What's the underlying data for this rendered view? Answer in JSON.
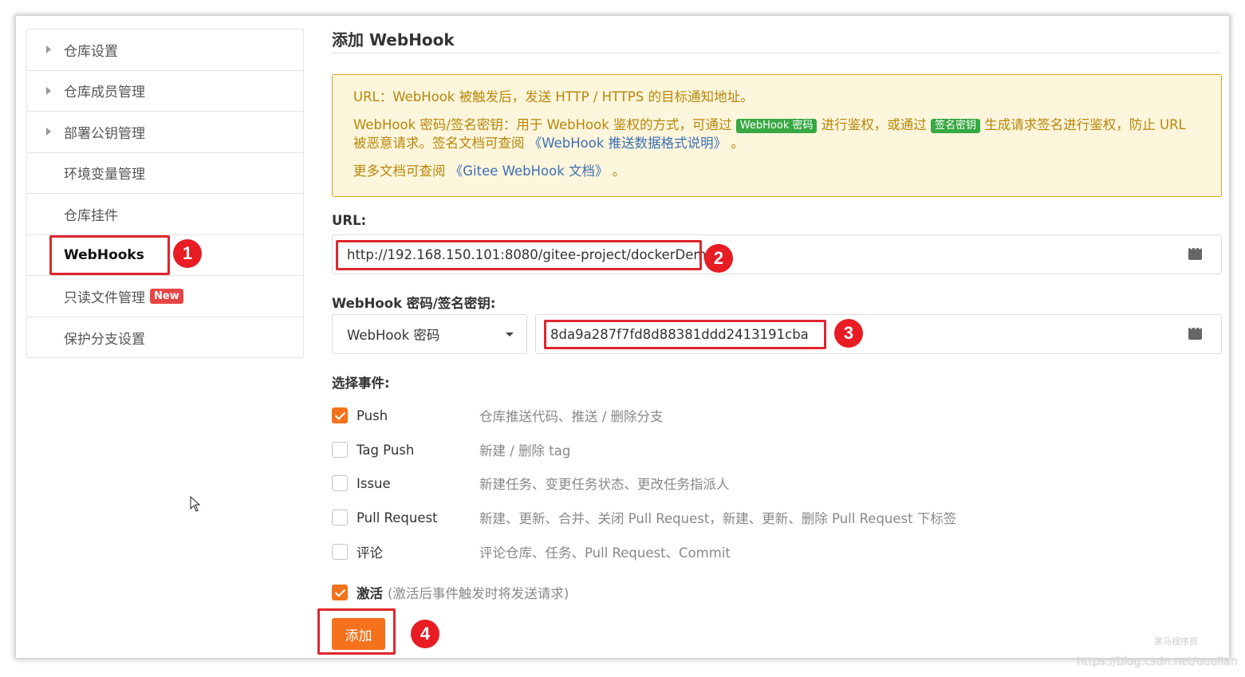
{
  "sidebar": {
    "items": [
      {
        "label": "仓库设置",
        "has_arrow": true
      },
      {
        "label": "仓库成员管理",
        "has_arrow": true
      },
      {
        "label": "部署公钥管理",
        "has_arrow": true
      },
      {
        "label": "环境变量管理",
        "has_arrow": false
      },
      {
        "label": "仓库挂件",
        "has_arrow": false
      },
      {
        "label": "WebHooks",
        "has_arrow": false,
        "active": true
      },
      {
        "label": "只读文件管理",
        "has_arrow": false,
        "badge": "New"
      },
      {
        "label": "保护分支设置",
        "has_arrow": false
      }
    ]
  },
  "main": {
    "title": "添加 WebHook",
    "notice": {
      "line1": "URL：WebHook 被触发后，发送 HTTP / HTTPS 的目标通知地址。",
      "line2_a": "WebHook 密码/签名密钥：用于 WebHook 鉴权的方式，可通过",
      "line2_tag1": "WebHook 密码",
      "line2_b": "进行鉴权，或通过",
      "line2_tag2": "签名密钥",
      "line2_c": "生成请求签名进行鉴权，防止 URL 被恶意请求。签名文档可查阅",
      "line2_link": "《WebHook 推送数据格式说明》",
      "line2_end": "。",
      "line3_a": "更多文档可查阅",
      "line3_link": "《Gitee WebHook 文档》",
      "line3_end": "。"
    },
    "url_label": "URL:",
    "url_value": "http://192.168.150.101:8080/gitee-project/dockerDemo",
    "secret_label": "WebHook 密码/签名密钥:",
    "secret_type": "WebHook 密码",
    "secret_value": "8da9a287f7fd8d88381ddd2413191cba",
    "events_label": "选择事件:",
    "events": [
      {
        "name": "Push",
        "desc": "仓库推送代码、推送 / 删除分支",
        "checked": true
      },
      {
        "name": "Tag Push",
        "desc": "新建 / 删除 tag",
        "checked": false
      },
      {
        "name": "Issue",
        "desc": "新建任务、变更任务状态、更改任务指派人",
        "checked": false
      },
      {
        "name": "Pull Request",
        "desc": "新建、更新、合并、关闭 Pull Request，新建、更新、删除 Pull Request 下标签",
        "checked": false
      },
      {
        "name": "评论",
        "desc": "评论仓库、任务、Pull Request、Commit",
        "checked": false
      }
    ],
    "activate_label": "激活",
    "activate_hint": "(激活后事件触发时将发送请求)",
    "activate_checked": true,
    "add_button": "添加"
  },
  "annotations": [
    "1",
    "2",
    "3",
    "4"
  ],
  "watermarks": {
    "brand": "黑马程序员",
    "url": "https://blog.csdn.net/uuulian"
  },
  "colors": {
    "accent": "#f5721c",
    "highlight_red": "#e0262e",
    "notice_bg": "#fdf6dc",
    "notice_text": "#b7860b",
    "tag_green": "#37a842",
    "badge_red": "#e64545"
  }
}
